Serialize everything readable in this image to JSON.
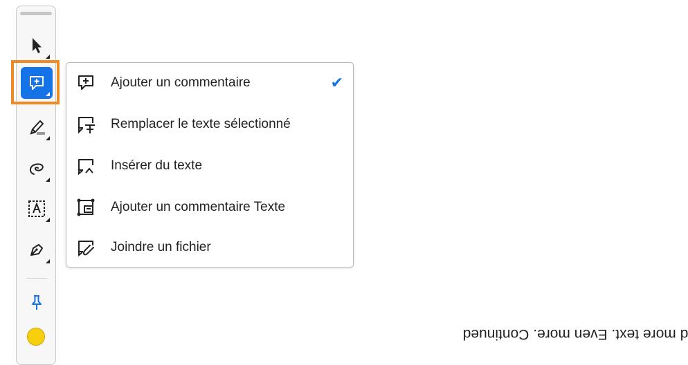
{
  "toolbar": {
    "tools": [
      {
        "name": "select-tool",
        "icon": "arrow-pointer-icon"
      },
      {
        "name": "comment-tool",
        "icon": "add-comment-icon",
        "active": true
      },
      {
        "name": "highlight-tool",
        "icon": "highlighter-icon"
      },
      {
        "name": "draw-tool",
        "icon": "lasso-icon"
      },
      {
        "name": "text-box-tool",
        "icon": "text-box-icon"
      },
      {
        "name": "signature-tool",
        "icon": "pen-nib-icon"
      },
      {
        "name": "pin-tool",
        "icon": "pushpin-icon"
      }
    ],
    "active_color": "#f7cf0c",
    "accent": "#1473e6",
    "highlight_outline": "#f08a24"
  },
  "menu": {
    "items": [
      {
        "label": "Ajouter un commentaire",
        "icon": "comment-plus-icon",
        "checked": true,
        "check_glyph": "✔"
      },
      {
        "label": "Remplacer le texte sélectionné",
        "icon": "comment-replace-text-icon"
      },
      {
        "label": "Insérer du texte",
        "icon": "comment-insert-text-icon"
      },
      {
        "label": "Ajouter un commentaire Texte",
        "icon": "text-comment-icon"
      },
      {
        "label": "Joindre un fichier",
        "icon": "attach-file-icon"
      }
    ]
  },
  "document": {
    "text": "nd more text. Even more. Continued"
  }
}
